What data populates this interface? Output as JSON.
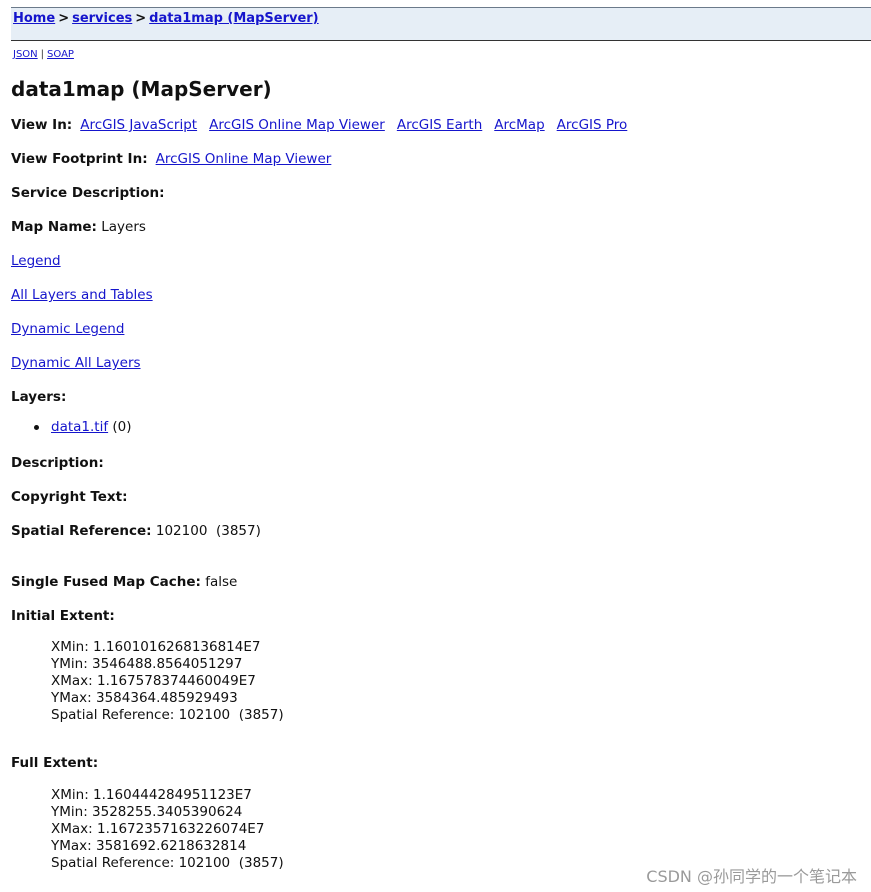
{
  "breadcrumb": {
    "home": "Home",
    "sep1": ">",
    "services": "services",
    "sep2": ">",
    "current": "data1map (MapServer)"
  },
  "formats": {
    "json": "JSON",
    "pipe": "|",
    "soap": "SOAP"
  },
  "title": "data1map (MapServer)",
  "view_in": {
    "label": "View In:",
    "links": [
      "ArcGIS JavaScript",
      "ArcGIS Online Map Viewer",
      "ArcGIS Earth",
      "ArcMap",
      "ArcGIS Pro"
    ]
  },
  "view_footprint": {
    "label": "View Footprint In:",
    "link": "ArcGIS Online Map Viewer"
  },
  "service_description": {
    "label": "Service Description:"
  },
  "map_name": {
    "label": "Map Name:",
    "value": "Layers"
  },
  "links": {
    "legend": "Legend",
    "all_layers": "All Layers and Tables",
    "dynamic_legend": "Dynamic Legend",
    "dynamic_all_layers": "Dynamic All Layers"
  },
  "layers": {
    "label": "Layers:",
    "items": [
      {
        "name": "data1.tif",
        "id": "(0)"
      }
    ]
  },
  "description": {
    "label": "Description:"
  },
  "copyright": {
    "label": "Copyright Text:"
  },
  "spatial_reference": {
    "label": "Spatial Reference:",
    "value": "102100  (3857)"
  },
  "single_fused": {
    "label": "Single Fused Map Cache:",
    "value": "false"
  },
  "initial_extent": {
    "label": "Initial Extent:",
    "xmin": "XMin: 1.1601016268136814E7",
    "ymin": "YMin: 3546488.8564051297",
    "xmax": "XMax: 1.167578374460049E7",
    "ymax": "YMax: 3584364.485929493",
    "sr": "Spatial Reference: 102100  (3857)"
  },
  "full_extent": {
    "label": "Full Extent:",
    "xmin": "XMin: 1.160444284951123E7",
    "ymin": "YMin: 3528255.3405390624",
    "xmax": "XMax: 1.1672357163226074E7",
    "ymax": "YMax: 3581692.6218632814",
    "sr": "Spatial Reference: 102100  (3857)"
  },
  "watermark": "CSDN @孙同学的一个笔记本"
}
